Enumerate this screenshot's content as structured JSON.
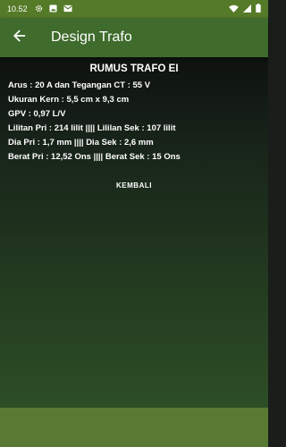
{
  "status_bar": {
    "time": "10.52",
    "icons": [
      "gear-icon",
      "image-icon",
      "mail-icon",
      "wifi-icon",
      "signal-icon",
      "battery-icon"
    ]
  },
  "app_bar": {
    "title": "Design Trafo",
    "back_icon": "arrow-back-icon"
  },
  "main": {
    "heading": "RUMUS TRAFO EI",
    "results": [
      "Arus : 20 A dan Tegangan CT : 55 V",
      "Ukuran Kern : 5,5 cm x 9,3 cm",
      "GPV : 0,97 L/V",
      "Lilitan Pri : 214 lilit |||| Lililan Sek : 107 lilit",
      "Dia Pri : 1,7 mm |||| Dia Sek : 2,6 mm",
      "Berat Pri : 12,52 Ons |||| Berat Sek : 15 Ons"
    ],
    "button_label": "KEMBALI"
  },
  "colors": {
    "status_bar": "#557a28",
    "app_bar": "#3f6b2c",
    "bottom_bar": "#587a33",
    "text": "#ffffff"
  }
}
